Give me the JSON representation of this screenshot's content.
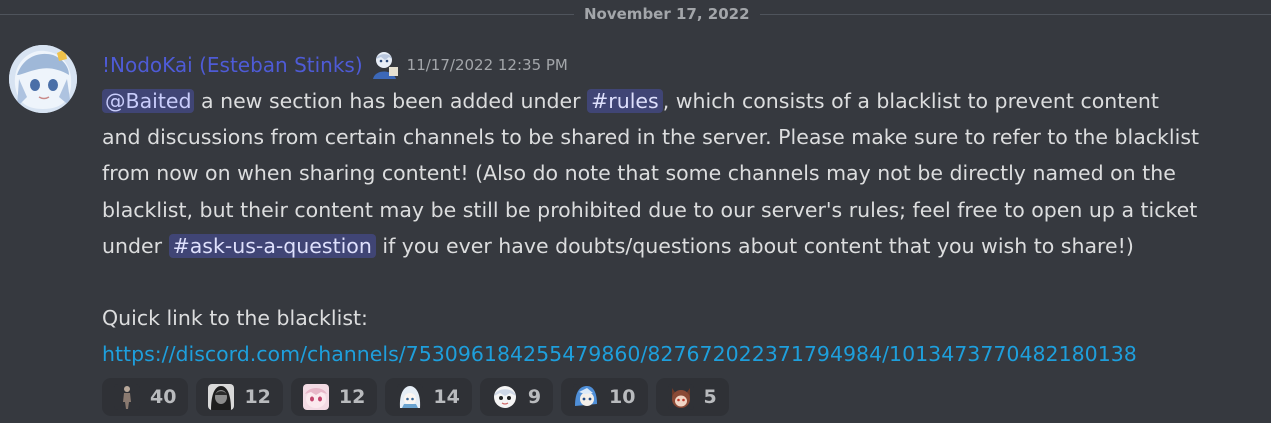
{
  "date_divider": "November 17, 2022",
  "message": {
    "author": "!NodoKai (Esteban Stinks)",
    "timestamp": "11/17/2022 12:35 PM",
    "line1": {
      "mention": "@Baited",
      "text_a": " a new section has been added under ",
      "channel": "#rules",
      "text_b": ", which consists of a blacklist to prevent content"
    },
    "line2": "and discussions from certain channels to be shared in the server. Please make sure to refer to the blacklist",
    "line3": "from now on when sharing content! (Also do note that some channels may not be directly named on the",
    "line4": "blacklist, but their content may be still be prohibited due to our server's rules; feel free to open up a ticket",
    "line5": {
      "text_a": "under ",
      "channel": "#ask-us-a-question",
      "text_b": " if you ever have doubts/questions about content that you wish to share!)"
    },
    "line7": "Quick link to the blacklist:",
    "link": "https://discord.com/channels/753096184255479860/827672022371794984/1013473770482180138"
  },
  "reactions": [
    {
      "emoji": "figure-emoji",
      "count": "40"
    },
    {
      "emoji": "dark-portrait-emoji",
      "count": "12"
    },
    {
      "emoji": "pink-face-emoji",
      "count": "12"
    },
    {
      "emoji": "white-hair-emoji",
      "count": "14"
    },
    {
      "emoji": "chibi-face-emoji",
      "count": "9"
    },
    {
      "emoji": "blue-hair-emoji",
      "count": "10"
    },
    {
      "emoji": "animal-ears-emoji",
      "count": "5"
    }
  ],
  "colors": {
    "background": "#36393f",
    "username": "#4e5bd6",
    "link": "#1e9fdc",
    "mention_bg": "rgba(88,101,242,0.3)"
  }
}
